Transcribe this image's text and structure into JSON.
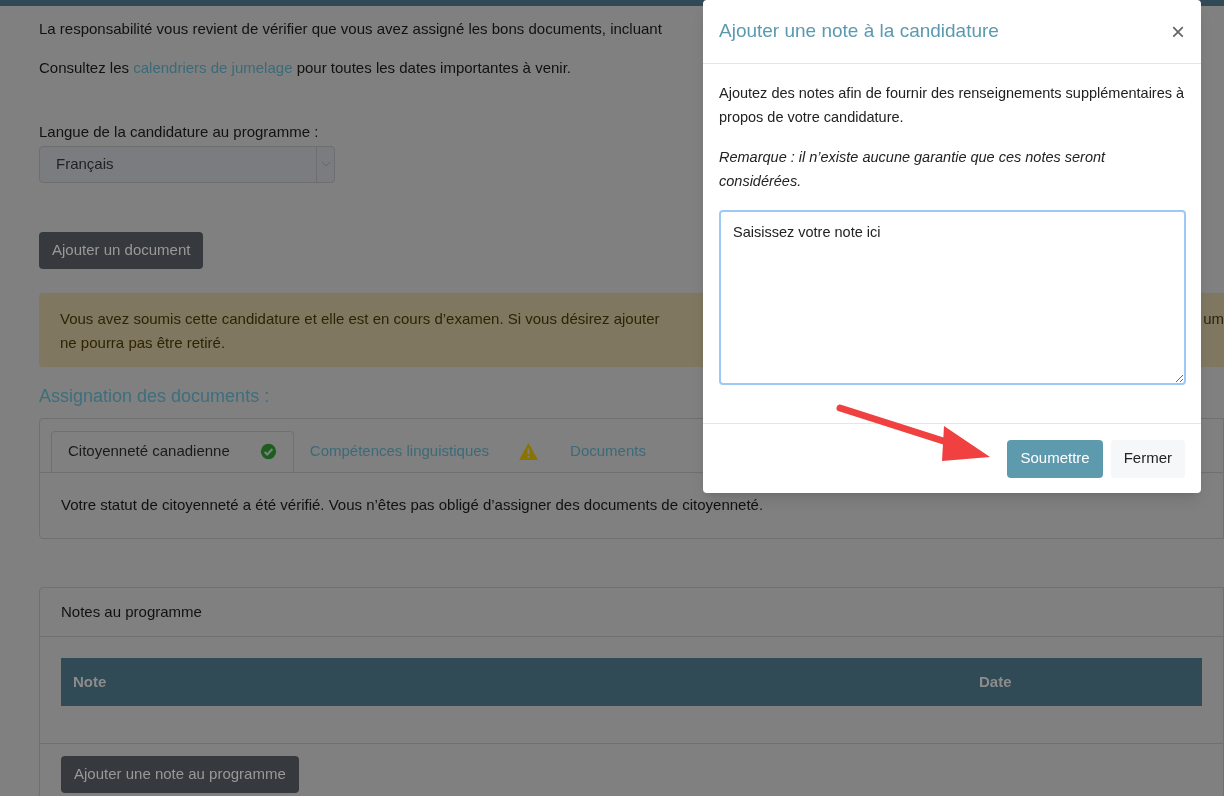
{
  "page": {
    "intro_text": "La responsabilité vous revient de vérifier que vous avez assigné les bons documents, incluant",
    "calendar_line": {
      "before": "Consultez les",
      "link": "calendriers de jumelage",
      "after": "pour toutes les dates importantes à venir."
    },
    "language": {
      "label": "Langue de la candidature au programme :",
      "value": "Français"
    },
    "add_document_button": "Ajouter un document",
    "warning": {
      "line_1": "Vous avez soumis cette candidature et elle est en cours d’examen. Si vous désirez ajouter",
      "line_1_end": "um",
      "line_2": "ne pourra pas être retiré."
    },
    "section_title": "Assignation des documents :",
    "tabs": [
      {
        "label": "Citoyenneté canadienne",
        "selected": true,
        "kind": "ok"
      },
      {
        "label": "Compétences linguistiques",
        "selected": false,
        "kind": "warning"
      },
      {
        "label": "Documents",
        "selected": false
      }
    ],
    "tab_content": "Votre statut de citoyenneté a été vérifié. Vous n’êtes pas obligé d’assigner des documents de citoyenneté.",
    "notes_panel": {
      "title": "Notes au programme",
      "columns": [
        "Note",
        "Date"
      ],
      "add_button": "Ajouter une note au programme"
    }
  },
  "modal": {
    "title": "Ajouter une note à la candidature",
    "close": "×",
    "description": "Ajoutez des notes afin de fournir des renseignements supplémentaires à propos de votre candidature.",
    "remark": "Remarque : il n’existe aucune garantie que ces notes seront considérées.",
    "note_value": "Saisissez votre note ici",
    "buttons": [
      {
        "label": "Soumettre",
        "kind": "primary"
      },
      {
        "label": "Fermer",
        "kind": "secondary"
      }
    ]
  }
}
